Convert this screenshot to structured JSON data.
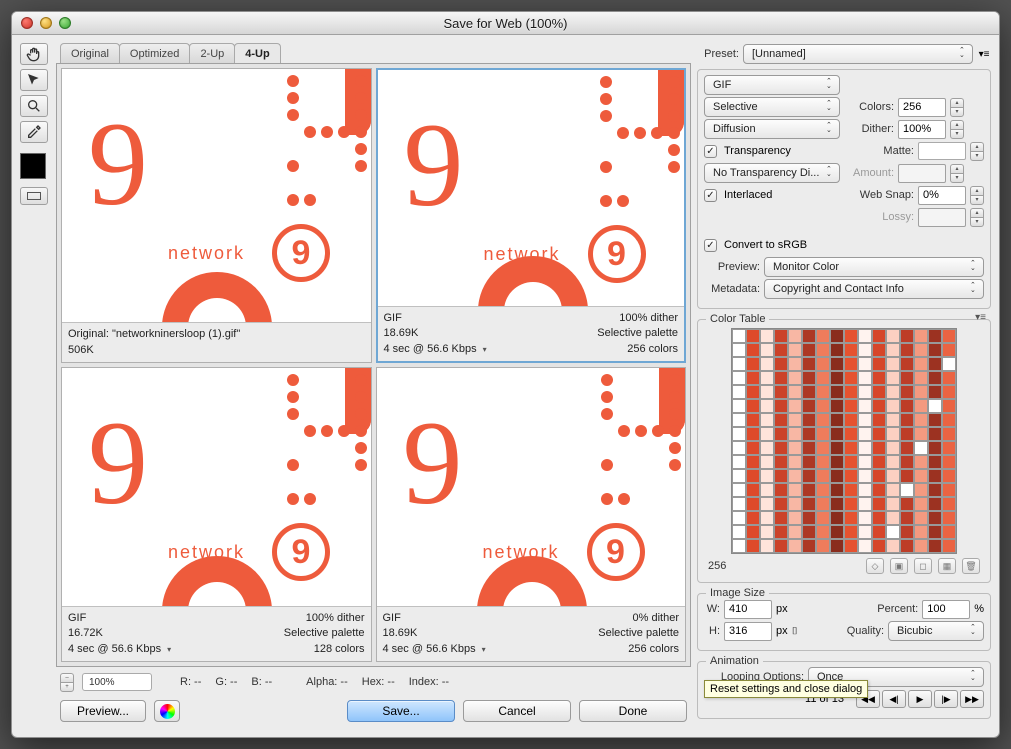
{
  "window": {
    "title": "Save for Web (100%)"
  },
  "tabs": {
    "original": "Original",
    "optimized": "Optimized",
    "twoup": "2-Up",
    "fourup": "4-Up"
  },
  "panes": {
    "p0": {
      "line1a": "Original: \"networkninersloop (1).gif\"",
      "line1b": "",
      "line2a": "506K",
      "line2b": "",
      "line3a": "",
      "line3b": ""
    },
    "p1": {
      "line1a": "GIF",
      "line1b": "100% dither",
      "line2a": "18.69K",
      "line2b": "Selective palette",
      "line3a": "4 sec @ 56.6 Kbps",
      "line3b": "256 colors"
    },
    "p2": {
      "line1a": "GIF",
      "line1b": "100% dither",
      "line2a": "16.72K",
      "line2b": "Selective palette",
      "line3a": "4 sec @ 56.6 Kbps",
      "line3b": "128 colors"
    },
    "p3": {
      "line1a": "GIF",
      "line1b": "0% dither",
      "line2a": "18.69K",
      "line2b": "Selective palette",
      "line3a": "4 sec @ 56.6 Kbps",
      "line3b": "256 colors"
    }
  },
  "statusbar": {
    "zoom": "100%",
    "r": "R: --",
    "g": "G: --",
    "b": "B: --",
    "alpha": "Alpha: --",
    "hex": "Hex: --",
    "index": "Index: --"
  },
  "footer": {
    "preview": "Preview...",
    "save": "Save...",
    "cancel": "Cancel",
    "done": "Done"
  },
  "preset": {
    "label": "Preset:",
    "value": "[Unnamed]",
    "format": "GIF",
    "reduction": "Selective",
    "colors_label": "Colors:",
    "colors": "256",
    "dither_method": "Diffusion",
    "dither_label": "Dither:",
    "dither": "100%",
    "transparency": "Transparency",
    "matte_label": "Matte:",
    "trans_dither": "No Transparency Di...",
    "amount_label": "Amount:",
    "interlaced": "Interlaced",
    "websnap_label": "Web Snap:",
    "websnap": "0%",
    "lossy_label": "Lossy:",
    "srgb": "Convert to sRGB",
    "preview_label": "Preview:",
    "preview_value": "Monitor Color",
    "metadata_label": "Metadata:",
    "metadata_value": "Copyright and Contact Info"
  },
  "colortable": {
    "legend": "Color Table",
    "count": "256"
  },
  "imagesize": {
    "legend": "Image Size",
    "w_label": "W:",
    "w": "410",
    "px": "px",
    "h_label": "H:",
    "h": "316",
    "percent_label": "Percent:",
    "percent": "100",
    "pct": "%",
    "quality_label": "Quality:",
    "quality": "Bicubic"
  },
  "animation": {
    "legend": "Animation",
    "looping_label": "Looping Options:",
    "looping": "Once",
    "frame": "11 of 13"
  },
  "tooltip": "Reset settings and close dialog"
}
